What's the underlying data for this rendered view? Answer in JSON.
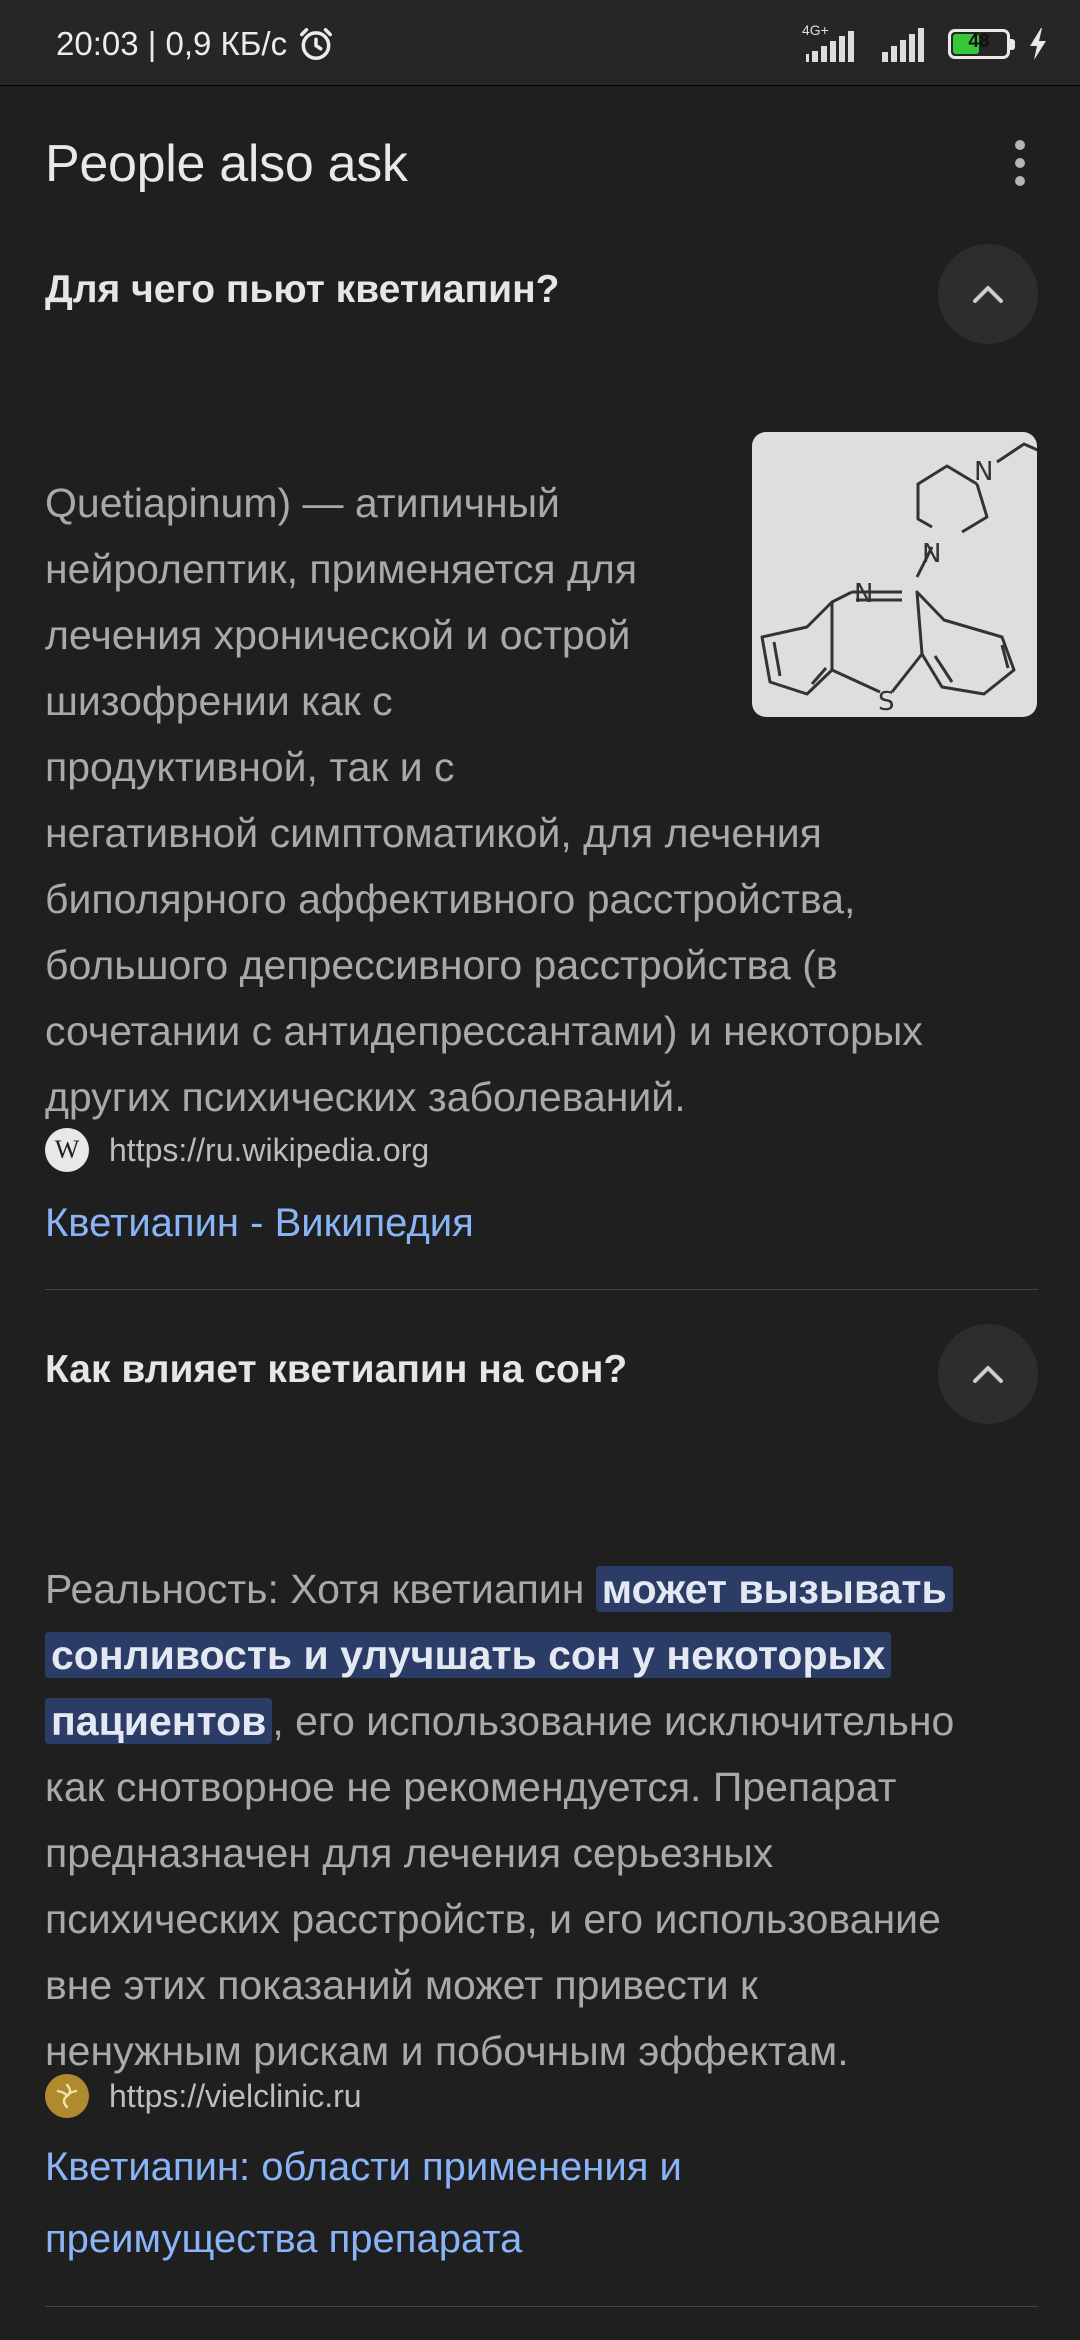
{
  "status_bar": {
    "time_speed": "20:03 | 0,9 КБ/с",
    "network": "4G+",
    "battery": "48"
  },
  "paa": {
    "title": "People also ask",
    "items": [
      {
        "question": "Для чего пьют кветиапин?",
        "answer_lines": [
          "Quetiapinum) — атипичный",
          "нейролептик, применяется для",
          "лечения хронической и острой",
          "шизофрении как с",
          "продуктивной, так и с",
          "негативной симптоматикой, для лечения",
          "биполярного аффективного расстройства,",
          "большого депрессивного расстройства (в",
          "сочетании с антидепрессантами) и некоторых",
          "других психических заболеваний."
        ],
        "source_url": "https://ru.wikipedia.org",
        "favicon_letter": "W",
        "link_lines": [
          "Кветиапин - Википедия"
        ]
      },
      {
        "question": "Как влияет кветиапин на сон?",
        "answer_parts": {
          "l1_plain": "Реальность: Хотя кветиапин ",
          "l1_hl": "может вызывать",
          "l2_hl": "сонливость и улучшать сон у некоторых",
          "l3_hl": "пациентов",
          "l3_plain": ", его использование исключительно",
          "rest": [
            "как снотворное не рекомендуется. Препарат",
            "предназначен для лечения серьезных",
            "психических расстройств, и его использование",
            "вне этих показаний может привести к",
            "ненужным рискам и побочным эффектам."
          ]
        },
        "source_url": "https://vielclinic.ru",
        "link_lines": [
          "Кветиапин: области применения и",
          "преимущества препарата"
        ]
      }
    ]
  },
  "molecule_labels": {
    "n1": "N",
    "n2": "N",
    "n3": "N",
    "s": "S"
  },
  "colors": {
    "background": "#1f1f1f",
    "link": "#8ab4f8",
    "highlight": "#2b3c67",
    "battery": "#38c73b"
  }
}
